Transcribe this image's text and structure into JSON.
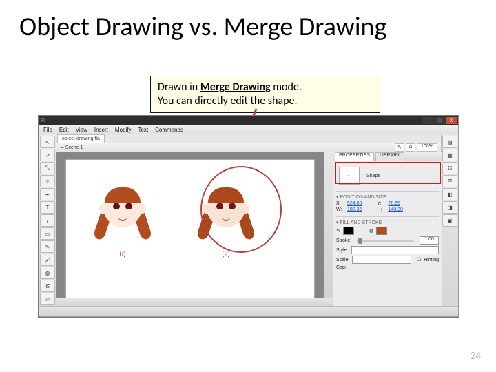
{
  "slide": {
    "title": "Object Drawing vs. Merge Drawing",
    "pageNumber": "24"
  },
  "callout": {
    "prefix": "Drawn in ",
    "mode": "Merge Drawing",
    "suffix": " mode.",
    "line2": "You can directly edit the shape."
  },
  "app": {
    "fileTab": "object-drawing.fla",
    "windowButtons": {
      "min": "–",
      "max": "□",
      "close": "X"
    },
    "menu": [
      "File",
      "Edit",
      "View",
      "Insert",
      "Modify",
      "Text",
      "Commands"
    ],
    "sceneLabel": "Scene 1",
    "zoom": "100%",
    "stage": {
      "labels": [
        "(i)",
        "(ii)"
      ]
    },
    "panel": {
      "tabs": [
        "PROPERTIES",
        "LIBRARY"
      ],
      "typeLabel": "Shape",
      "sectionPos": "POSITION AND SIZE",
      "x": {
        "k": "X:",
        "v": "524.00"
      },
      "y": {
        "k": "Y:",
        "v": "78.65"
      },
      "w": {
        "k": "W:",
        "v": "182.35"
      },
      "h": {
        "k": "H:",
        "v": "148.30"
      },
      "sectionFill": "FILL AND STROKE",
      "strokeLabel": "Stroke:",
      "strokeVal": "1.00",
      "styleLabel": "Style:",
      "scaleLabel": "Scale:",
      "hintingLabel": "Hinting",
      "capLabel": "Cap:"
    }
  }
}
